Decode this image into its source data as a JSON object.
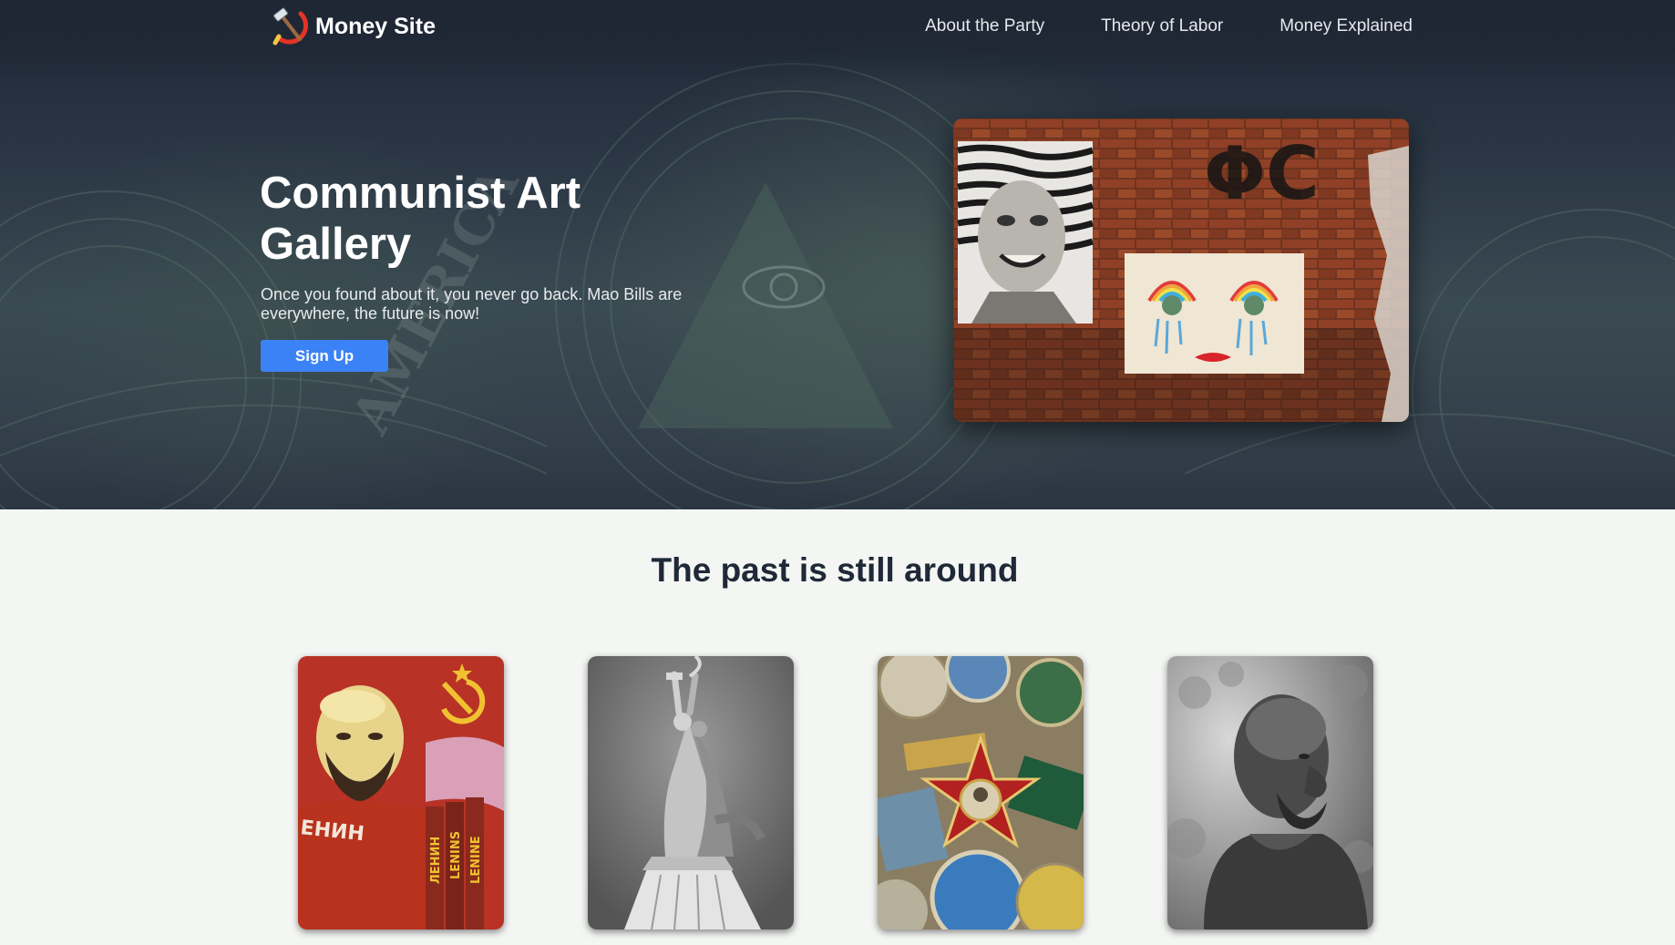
{
  "header": {
    "brand": "Money Site",
    "brand_logo_icon": "hammer-and-sickle-icon",
    "nav": [
      "About the Party",
      "Theory of Labor",
      "Money Explained"
    ]
  },
  "hero": {
    "title": "Communist Art Gallery",
    "subtitle": "Once you found about it, you never go back. Mao Bills are everywhere, the future is now!",
    "cta_label": "Sign Up",
    "image_text": "ΦC"
  },
  "gallery": {
    "title": "The past is still around",
    "cards": [
      {
        "image": "lenin-mosaic",
        "mosaic_text": "ЕНИН",
        "banner_texts": [
          "ЛЕНИН",
          "LENINS",
          "LENINE"
        ]
      },
      {
        "image": "worker-and-kolkhoz-woman-statue"
      },
      {
        "image": "soviet-pins"
      },
      {
        "image": "lenin-bust"
      }
    ]
  },
  "colors": {
    "header_bg": "#1f2735",
    "accent": "#3b82f6",
    "page_bg": "#f4f6f4",
    "heading": "#1f2937"
  }
}
